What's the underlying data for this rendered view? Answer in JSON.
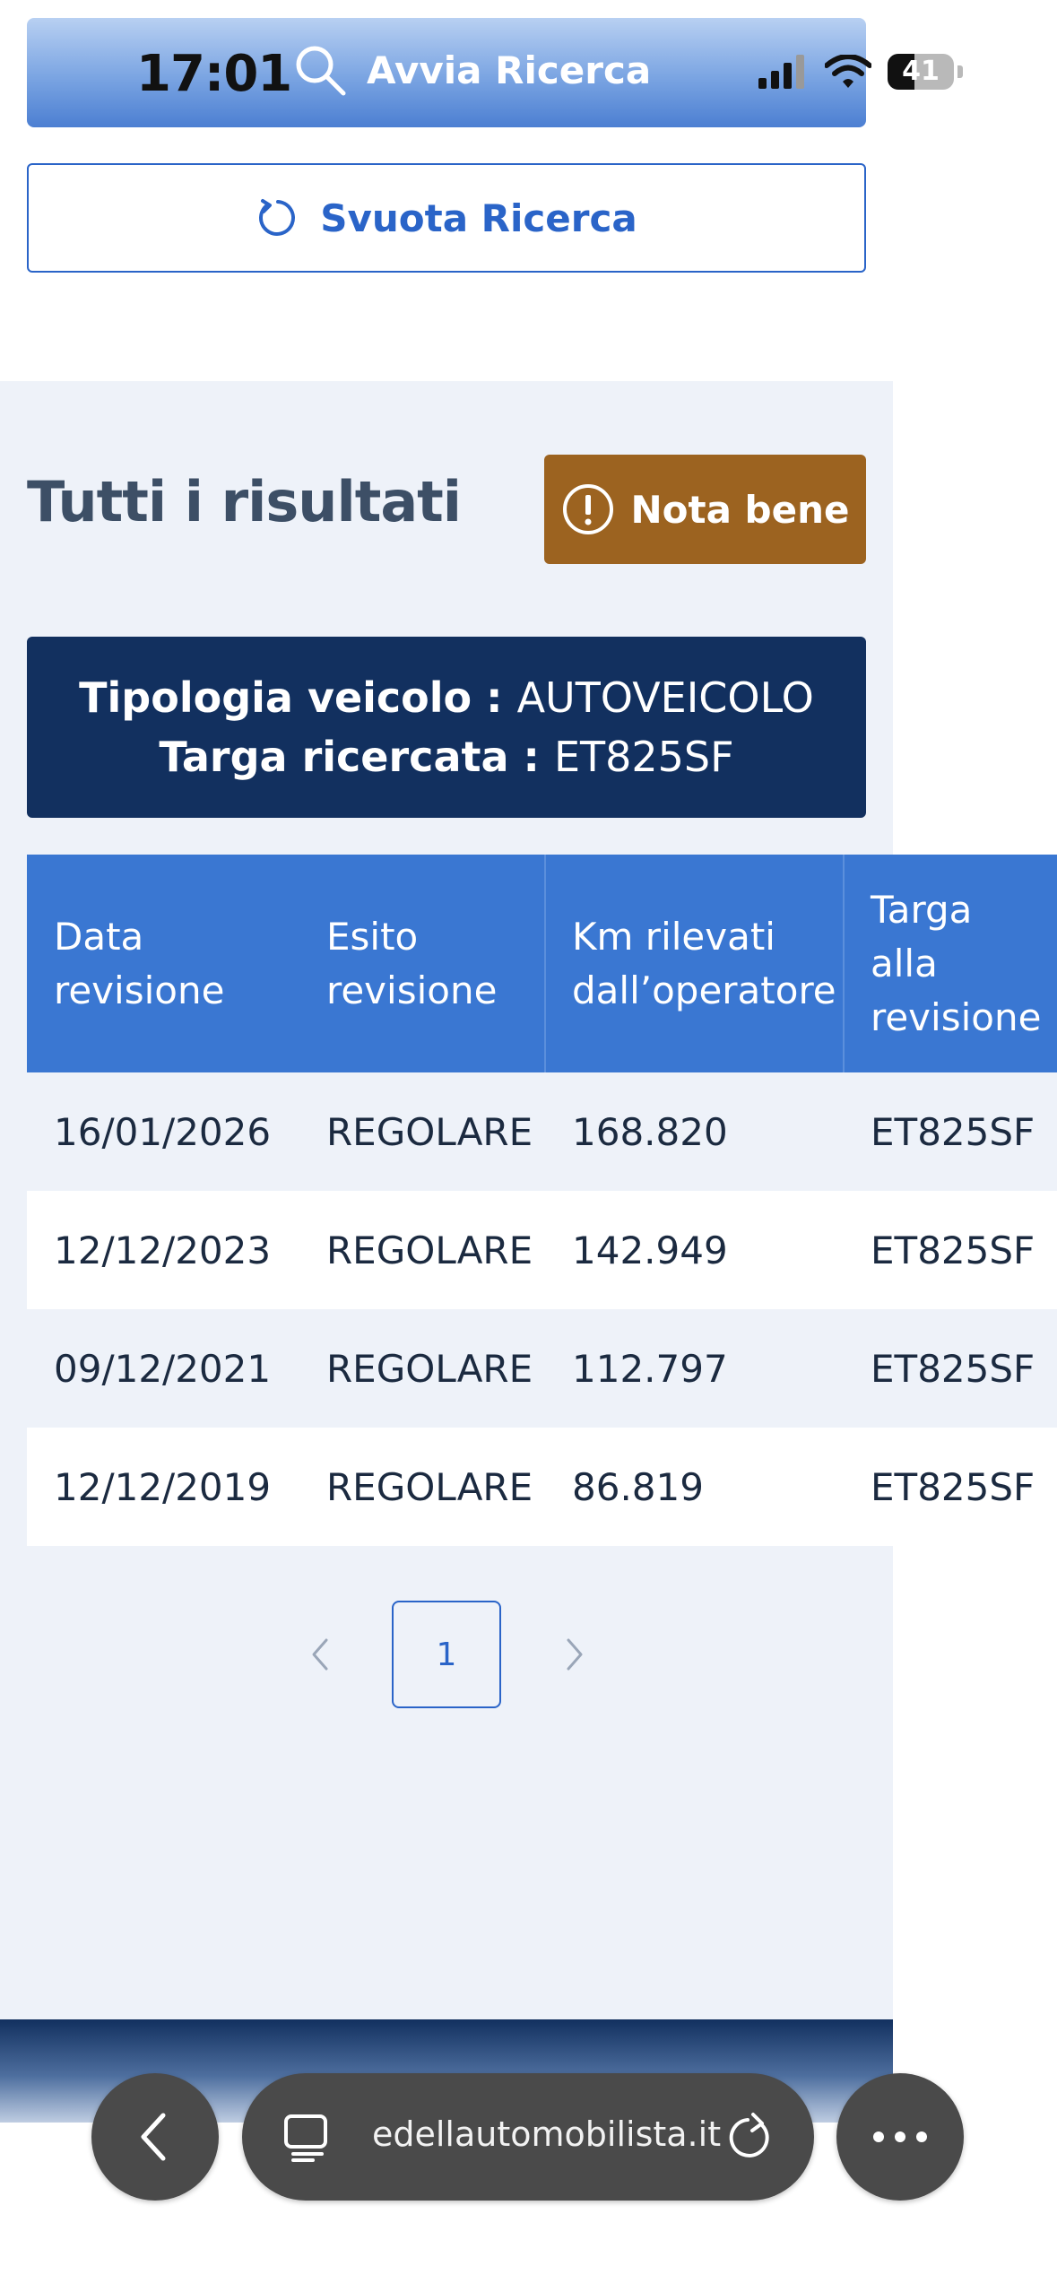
{
  "status_bar": {
    "time": "17:01",
    "battery": "41",
    "battery_level_percent": 41,
    "icons": [
      "signal-icon",
      "wifi-icon",
      "battery-icon"
    ]
  },
  "search_button": {
    "label": "Avvia Ricerca",
    "icon": "search-icon"
  },
  "reset_button": {
    "label": "Svuota Ricerca",
    "icon": "refresh-icon"
  },
  "results": {
    "title": "Tutti i risultati",
    "nota_button": {
      "label": "Nota bene",
      "icon": "exclamation-icon"
    },
    "info": {
      "vehicle_type_label": "Tipologia veicolo :",
      "vehicle_type_value": "AUTOVEICOLO",
      "plate_label": "Targa ricercata :",
      "plate_value": "ET825SF"
    }
  },
  "table": {
    "headers": [
      [
        "Data",
        "revisione"
      ],
      [
        "Esito",
        "revisione"
      ],
      [
        "Km rilevati",
        "dall’operatore"
      ],
      [
        "Targa",
        "alla",
        "revisione"
      ]
    ],
    "rows": [
      [
        "16/01/2026",
        "REGOLARE",
        "168.820",
        "ET825SF"
      ],
      [
        "12/12/2023",
        "REGOLARE",
        "142.949",
        "ET825SF"
      ],
      [
        "09/12/2021",
        "REGOLARE",
        "112.797",
        "ET825SF"
      ],
      [
        "12/12/2019",
        "REGOLARE",
        "86.819",
        "ET825SF"
      ]
    ]
  },
  "pagination": {
    "current_page": "1"
  },
  "browser": {
    "url": "edellautomobilista.it",
    "buttons": [
      "back-icon",
      "tabs-icon",
      "reload-icon",
      "more-icon"
    ]
  },
  "colors": {
    "accent_blue": "#2a64c8",
    "header_blue": "#3a77d2",
    "navy": "#12305f",
    "nota_brown": "#9c6320"
  }
}
